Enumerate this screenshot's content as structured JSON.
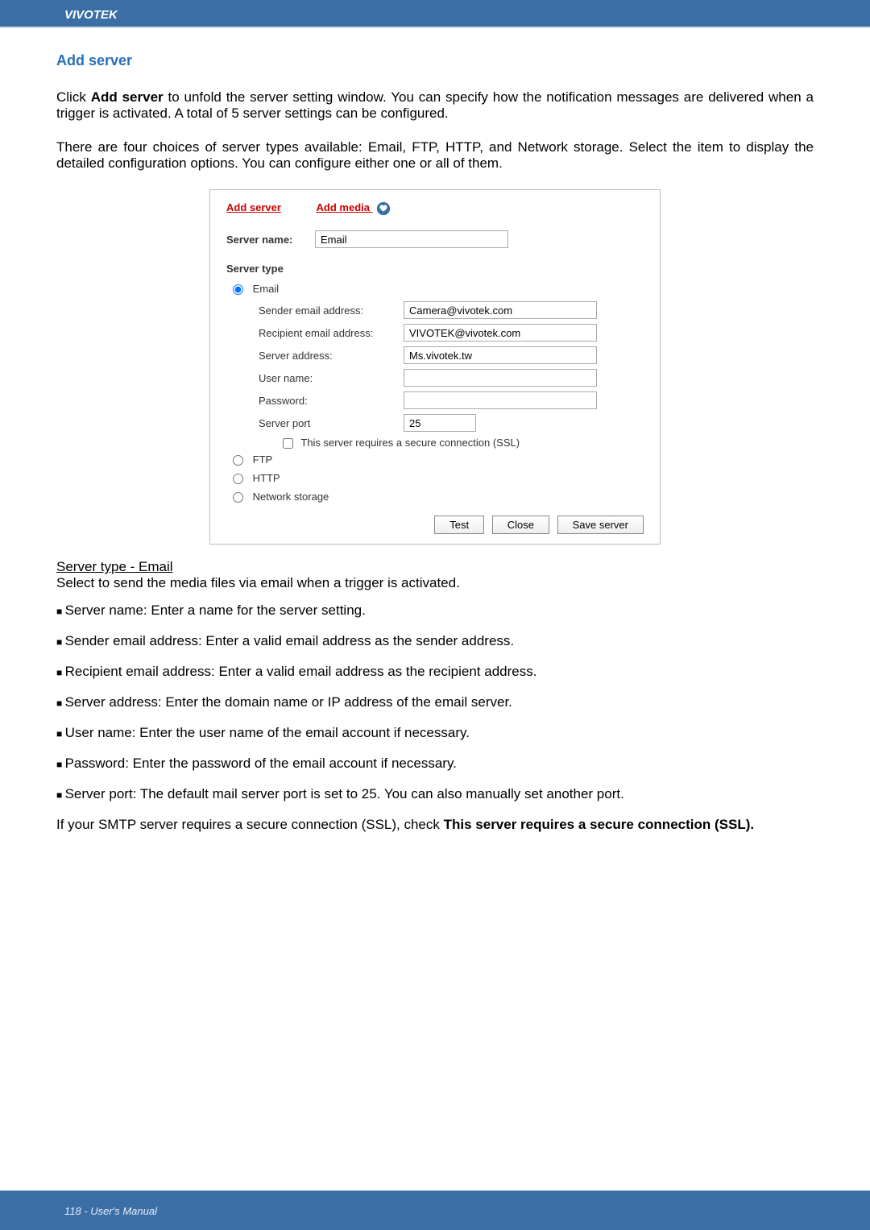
{
  "header": {
    "brand": "VIVOTEK"
  },
  "section": {
    "title": "Add server"
  },
  "intro": {
    "p1a": "Click ",
    "p1b": "Add server",
    "p1c": " to unfold the server setting window. You can specify how the notification messages are delivered when a trigger is activated. A total of 5 server settings can be configured.",
    "p2": "There are four choices of server types available: Email, FTP, HTTP, and Network storage. Select the item to display the detailed configuration options. You can configure either one or all of them."
  },
  "dialog": {
    "links": {
      "add_server": "Add server",
      "add_media": "Add media"
    },
    "server_name_label": "Server name:",
    "server_name_value": "Email",
    "server_type_label": "Server type",
    "radios": {
      "email": "Email",
      "ftp": "FTP",
      "http": "HTTP",
      "network_storage": "Network storage"
    },
    "email": {
      "sender_label": "Sender email address:",
      "sender_value": "Camera@vivotek.com",
      "recipient_label": "Recipient email address:",
      "recipient_value": "VIVOTEK@vivotek.com",
      "server_label": "Server address:",
      "server_value": "Ms.vivotek.tw",
      "user_label": "User name:",
      "user_value": "",
      "pass_label": "Password:",
      "pass_value": "",
      "port_label": "Server port",
      "port_value": "25",
      "ssl_label": "This server requires a secure connection (SSL)"
    },
    "buttons": {
      "test": "Test",
      "close": "Close",
      "save": "Save server"
    }
  },
  "below": {
    "heading": "Server type - Email",
    "desc": "Select to send the media files via email when a trigger is activated.",
    "items": [
      "Server name: Enter a name for the server setting.",
      "Sender email address: Enter a valid email address as the sender address.",
      "Recipient email address: Enter a valid email address as the recipient address.",
      "Server address: Enter the domain name or IP address of the email server.",
      "User name: Enter the user name of the email account if necessary.",
      "Password: Enter the password of the email account if necessary.",
      "Server port: The default mail server port is set to 25. You can also manually set another port."
    ],
    "ssl_a": "If your SMTP server requires a secure connection (SSL), check ",
    "ssl_b": "This server requires a secure connection (SSL)."
  },
  "footer": {
    "text": "118 - User's Manual"
  }
}
